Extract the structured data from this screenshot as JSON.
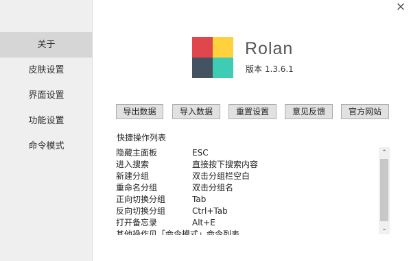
{
  "sidebar": {
    "items": [
      {
        "label": "关于",
        "active": true
      },
      {
        "label": "皮肤设置"
      },
      {
        "label": "界面设置"
      },
      {
        "label": "功能设置"
      },
      {
        "label": "命令模式"
      }
    ]
  },
  "window": {
    "close_icon": "×"
  },
  "app": {
    "name": "Rolan",
    "version": "版本 1.3.6.1",
    "logo_colors": [
      "#e0474c",
      "#ffd13c",
      "#435361",
      "#3ecdb4"
    ]
  },
  "buttons": {
    "export": "导出数据",
    "import": "导入数据",
    "reset": "重置设置",
    "feedback": "意见反馈",
    "website": "官方网站"
  },
  "shortcuts": {
    "title": "快捷操作列表",
    "rows": [
      {
        "action": "隐藏主面板",
        "key": "ESC"
      },
      {
        "action": "进入搜索",
        "key": "直接按下搜索内容"
      },
      {
        "action": "新建分组",
        "key": "双击分组栏空白"
      },
      {
        "action": "重命名分组",
        "key": "双击分组名"
      },
      {
        "action": "正向切换分组",
        "key": "Tab"
      },
      {
        "action": "反向切换分组",
        "key": "Ctrl+Tab"
      },
      {
        "action": "打开备忘录",
        "key": "Alt+E"
      },
      {
        "action": "其他操作见「命令模式」命令列表",
        "key": ""
      }
    ]
  },
  "scrollbar": {
    "up_icon": "⌃",
    "down_icon": "⌄",
    "position": 0.0
  }
}
